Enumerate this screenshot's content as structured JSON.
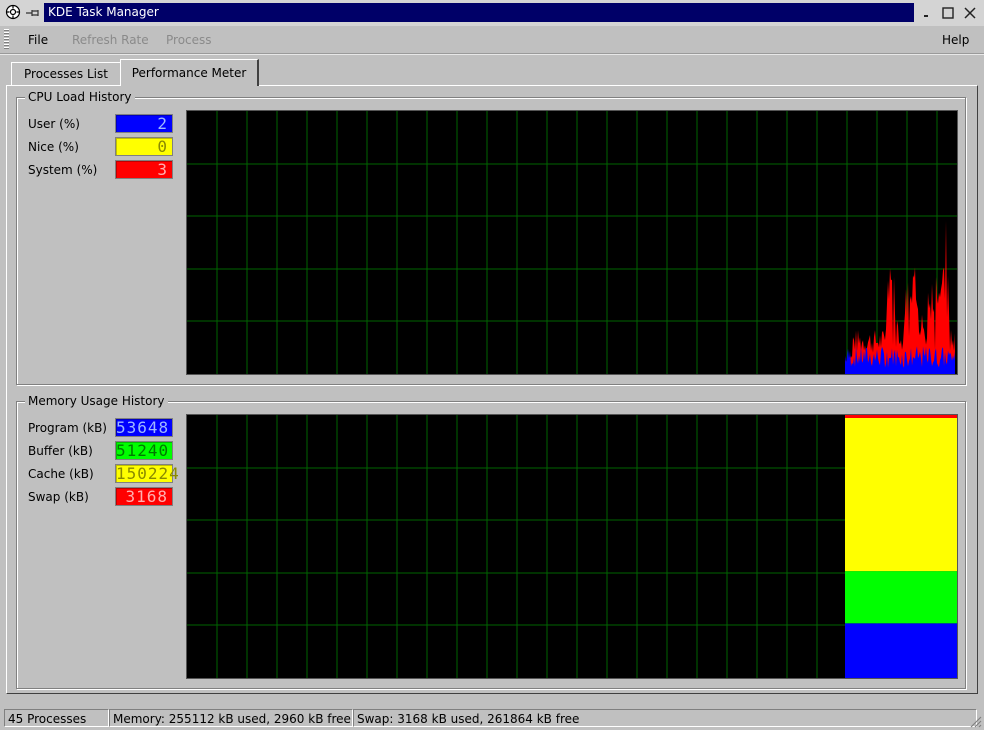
{
  "window": {
    "title": "KDE Task Manager",
    "icons": [
      "app-icon",
      "pin-icon",
      "minimize-icon",
      "maximize-icon",
      "close-icon"
    ]
  },
  "menu": {
    "file": "File",
    "refresh_rate": "Refresh Rate",
    "process": "Process",
    "help": "Help"
  },
  "tabs": {
    "processes": "Processes List",
    "performance": "Performance Meter",
    "active": "performance"
  },
  "cpu": {
    "title": "CPU Load History",
    "meters": [
      {
        "label": "User (%)",
        "value": "2",
        "color": "#0000ff"
      },
      {
        "label": "Nice (%)",
        "value": "0",
        "color": "#ffff00"
      },
      {
        "label": "System (%)",
        "value": "3",
        "color": "#ff0000"
      }
    ]
  },
  "memory": {
    "title": "Memory Usage History",
    "meters": [
      {
        "label": "Program (kB)",
        "value": "53648",
        "color": "#0000ff"
      },
      {
        "label": "Buffer (kB)",
        "value": "51240",
        "color": "#00ff00"
      },
      {
        "label": "Cache (kB)",
        "value": "150224",
        "color": "#ffff00"
      },
      {
        "label": "Swap (kB)",
        "value": "3168",
        "color": "#ff0000"
      }
    ]
  },
  "status": {
    "processes": "45 Processes",
    "memory": "Memory: 255112 kB used, 2960 kB free",
    "swap": "Swap: 3168 kB used, 261864 kB free"
  },
  "colors": {
    "title_bg": "#000068",
    "grid": "#006400",
    "plot_bg": "#000000"
  }
}
